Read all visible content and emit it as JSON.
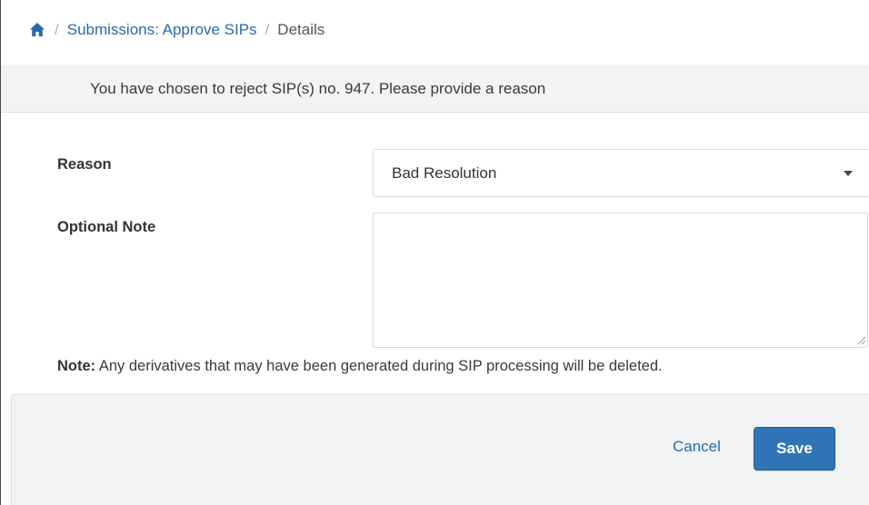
{
  "breadcrumb": {
    "home_icon": "home-icon",
    "separator": "/",
    "link": "Submissions: Approve SIPs",
    "current": "Details"
  },
  "info": {
    "message": "You have chosen to reject SIP(s) no. 947. Please provide a reason"
  },
  "form": {
    "reason_label": "Reason",
    "reason_value": "Bad Resolution",
    "note_label": "Optional Note",
    "note_value": "",
    "footnote_prefix": "Note:",
    "footnote_text": " Any derivatives that may have been generated during SIP processing will be deleted."
  },
  "actions": {
    "cancel_label": "Cancel",
    "save_label": "Save"
  },
  "colors": {
    "link": "#2a68ad",
    "primary_button": "#2f75b6",
    "panel_bg": "#f2f3f5"
  }
}
